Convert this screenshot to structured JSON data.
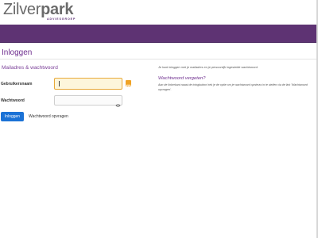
{
  "header": {
    "logo_part1": "Zilver",
    "logo_part2": "park",
    "logo_tagline": "ADVIESGROEP"
  },
  "page": {
    "title": "Inloggen"
  },
  "login_form": {
    "section_title": "Mailadres & wachtwoord",
    "username_label": "Gebruikersnaam",
    "username_value": "",
    "password_label": "Wachtwoord",
    "password_value": "",
    "login_button_label": "Inloggen",
    "forgot_link_label": "Wachtwoord opvragen"
  },
  "info_panel": {
    "intro_text": "Je kunt inloggen met je mailadres en je persoonlijk ingestelde wachtwoord.",
    "forgot_title": "Wachtwoord vergeten?",
    "forgot_text": "Aan de linkerkant naast de inlogbutton heb je de optie om je wachtwoord opnieuw in te stellen via de link 'Wachtwoord opvragen'."
  },
  "colors": {
    "brand_purple": "#5e3373",
    "title_purple": "#6f2f8f",
    "button_blue": "#1b72d6",
    "focus_orange": "#e8a93a"
  },
  "icons": {
    "key": "key-icon",
    "eye": "eye-icon"
  }
}
